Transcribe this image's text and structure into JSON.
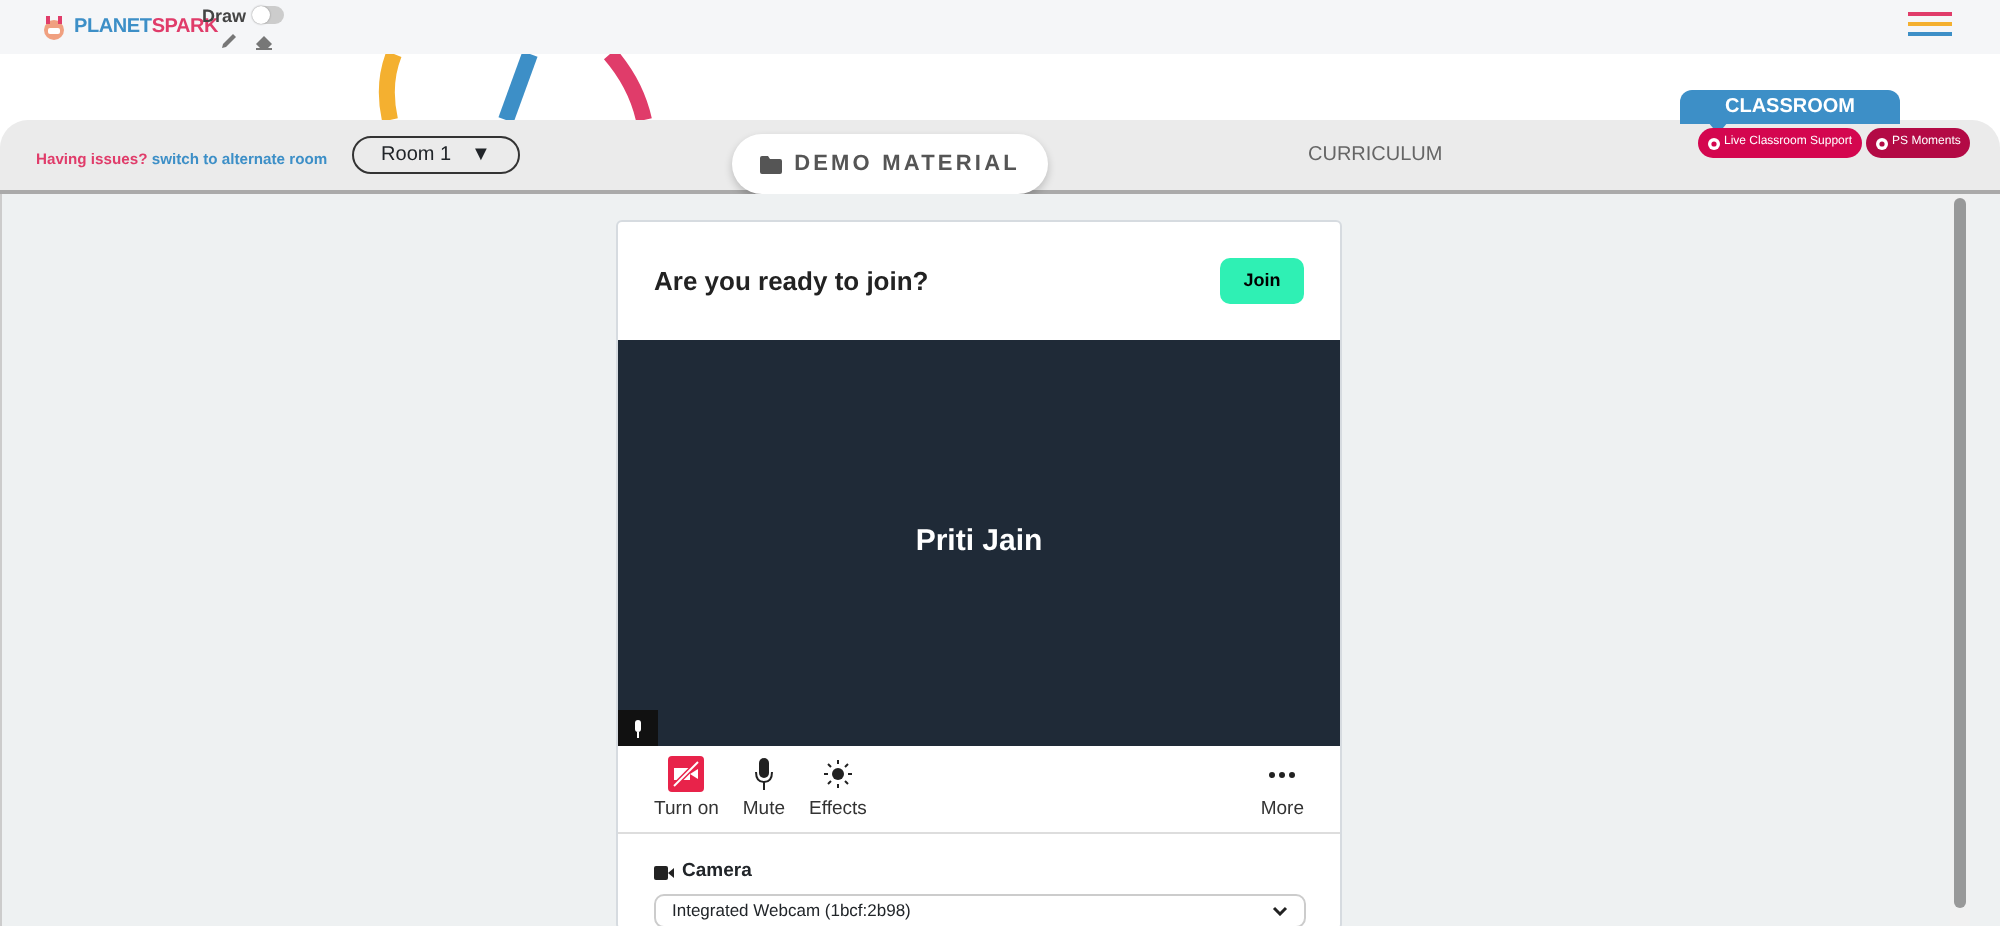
{
  "brand": {
    "name_part1": "PLANET",
    "name_part2": "SPARK"
  },
  "draw": {
    "label": "Draw",
    "on": false
  },
  "issues": {
    "prompt": "Having issues?",
    "link": "switch to alternate room"
  },
  "room_select": {
    "value": "Room 1",
    "caret": "▼"
  },
  "nav": [
    {
      "label": "DEMO MATERIAL",
      "selected": true
    },
    {
      "label": "CURRICULUM",
      "selected": false
    }
  ],
  "classroom_tab": "CLASSROOM",
  "support_buttons": [
    {
      "label": "Live Classroom Support",
      "color": "#d4064f"
    },
    {
      "label": "PS Moments",
      "color": "#b30a45"
    }
  ],
  "prejoin": {
    "title": "Are you ready to join?",
    "join_button": "Join",
    "participant": "Priti Jain",
    "camera_on": false,
    "controls": [
      {
        "kind": "camera",
        "label": "Turn on"
      },
      {
        "kind": "mic",
        "label": "Mute"
      },
      {
        "kind": "effects",
        "label": "Effects"
      },
      {
        "kind": "more",
        "label": "More"
      }
    ],
    "camera_label": "Camera",
    "camera_device": "Integrated Webcam (1bcf:2b98)"
  }
}
